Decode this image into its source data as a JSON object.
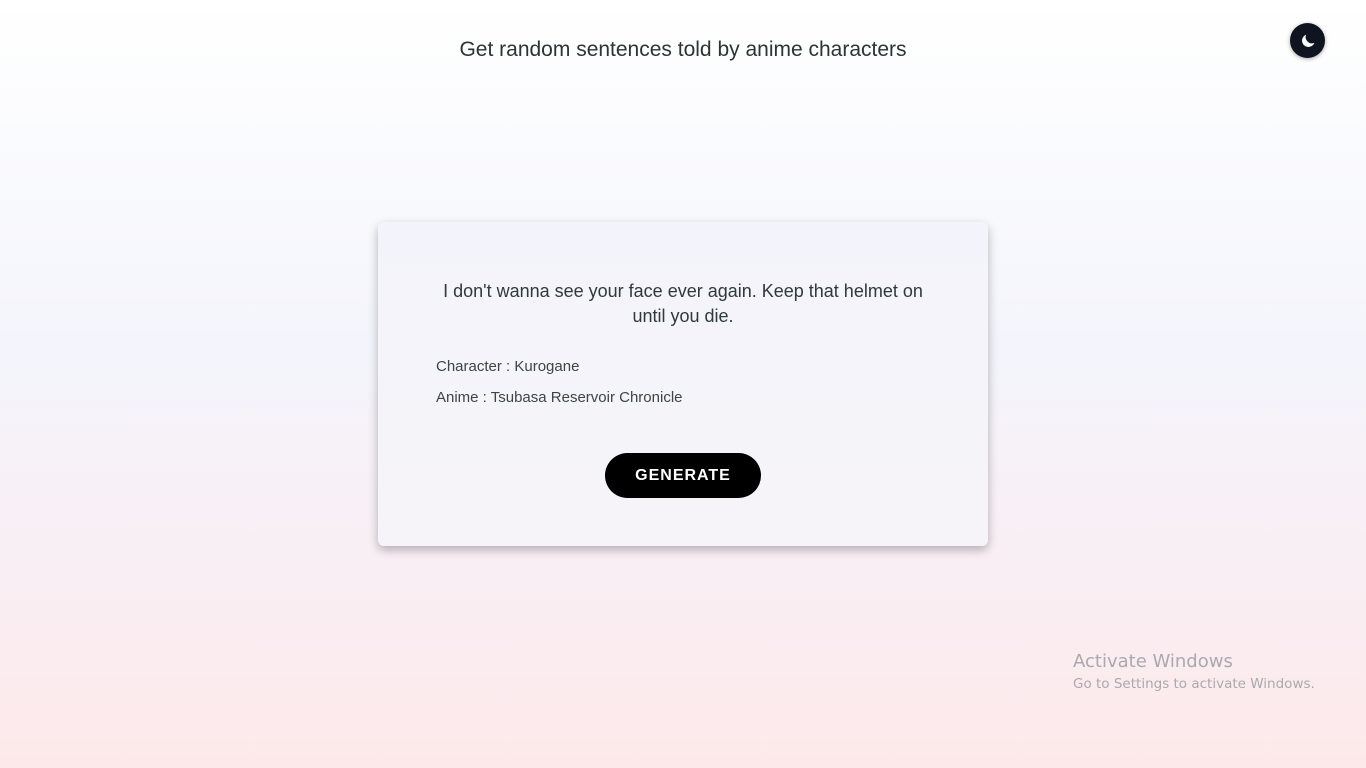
{
  "header": {
    "title": "Get random sentences told by anime characters"
  },
  "theme_toggle": {
    "icon": "moon-icon",
    "background": "#0f1420"
  },
  "quote_card": {
    "quote": "I don't wanna see your face ever again. Keep that helmet on until you die.",
    "character_line": "Character : Kurogane",
    "anime_line": "Anime : Tsubasa Reservoir Chronicle",
    "generate_label": "GENERATE"
  },
  "os_watermark": {
    "title": "Activate Windows",
    "subtitle": "Go to Settings to activate Windows."
  },
  "colors": {
    "button_bg": "#000000",
    "button_text": "#ffffff",
    "text": "#2f3a3a"
  }
}
